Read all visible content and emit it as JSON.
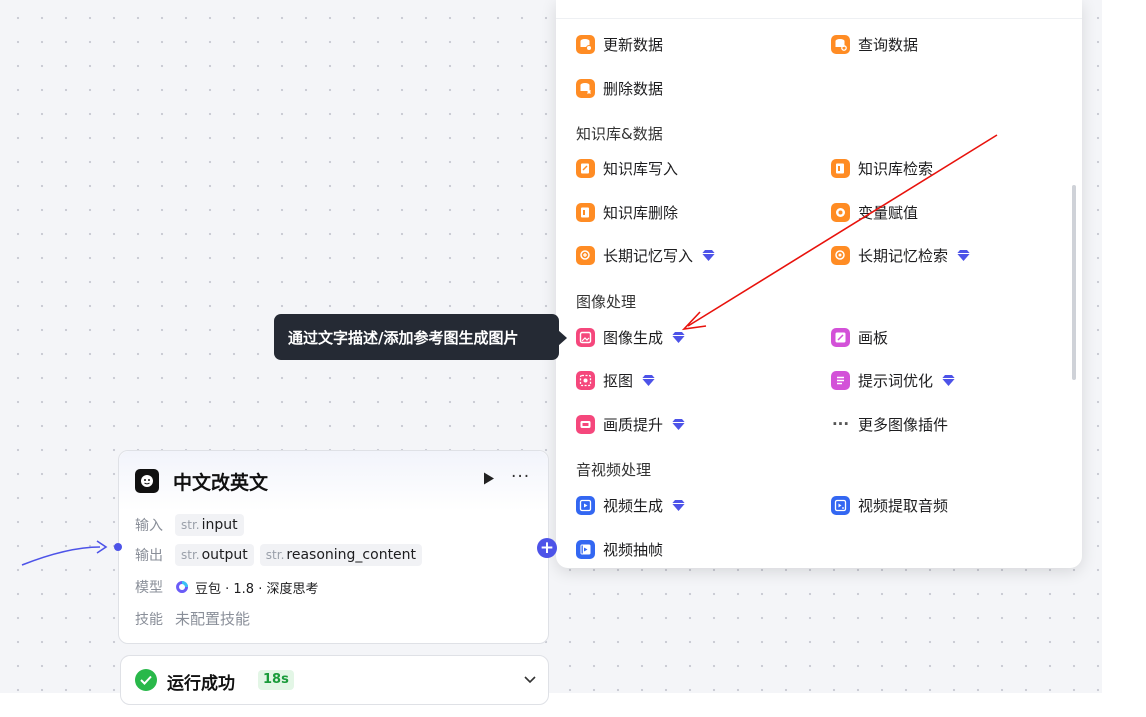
{
  "panel": {
    "rows_top": [
      {
        "label": "更新数据",
        "icon": "update-data-icon",
        "color": "orange"
      },
      {
        "label": "查询数据",
        "icon": "query-data-icon",
        "color": "orange"
      },
      {
        "label": "删除数据",
        "icon": "delete-data-icon",
        "color": "orange"
      }
    ],
    "sections": {
      "knowledge": "知识库&数据",
      "image": "图像处理",
      "av": "音视频处理"
    },
    "knowledge_items": [
      {
        "label": "知识库写入",
        "icon": "knowledge-write-icon",
        "color": "orange"
      },
      {
        "label": "知识库检索",
        "icon": "knowledge-search-icon",
        "color": "orange"
      },
      {
        "label": "知识库删除",
        "icon": "knowledge-delete-icon",
        "color": "orange"
      },
      {
        "label": "变量赋值",
        "icon": "variable-assign-icon",
        "color": "orange"
      },
      {
        "label": "长期记忆写入",
        "icon": "memory-write-icon",
        "color": "orange",
        "premium": true
      },
      {
        "label": "长期记忆检索",
        "icon": "memory-search-icon",
        "color": "orange",
        "premium": true
      }
    ],
    "image_items": [
      {
        "label": "图像生成",
        "icon": "image-generate-icon",
        "color": "pink",
        "premium": true
      },
      {
        "label": "画板",
        "icon": "canvas-board-icon",
        "color": "purple"
      },
      {
        "label": "抠图",
        "icon": "cutout-icon",
        "color": "pink",
        "premium": true
      },
      {
        "label": "提示词优化",
        "icon": "prompt-optimize-icon",
        "color": "purple",
        "premium": true
      },
      {
        "label": "画质提升",
        "icon": "hd-upscale-icon",
        "color": "pink",
        "premium": true
      },
      {
        "label": "更多图像插件",
        "icon": "more-icon",
        "color": "grey"
      }
    ],
    "av_items": [
      {
        "label": "视频生成",
        "icon": "video-generate-icon",
        "color": "blue",
        "premium": true
      },
      {
        "label": "视频提取音频",
        "icon": "video-audio-icon",
        "color": "blue"
      },
      {
        "label": "视频抽帧",
        "icon": "video-frame-icon",
        "color": "blue"
      }
    ]
  },
  "tooltip": "通过文字描述/添加参考图生成图片",
  "node": {
    "title": "中文改英文",
    "input_label": "输入",
    "input_prefix": "str.",
    "input_name": "input",
    "output_label": "输出",
    "outputs": [
      {
        "prefix": "str.",
        "name": "output"
      },
      {
        "prefix": "str.",
        "name": "reasoning_content"
      }
    ],
    "model_label": "模型",
    "model_value": "豆包 · 1.8 · 深度思考",
    "skill_label": "技能",
    "skill_value": "未配置技能"
  },
  "status": {
    "text": "运行成功",
    "time": "18s"
  },
  "colors": {
    "accent": "#4d53e8",
    "annotation_arrow": "#e8120c",
    "success": "#29b84a"
  }
}
